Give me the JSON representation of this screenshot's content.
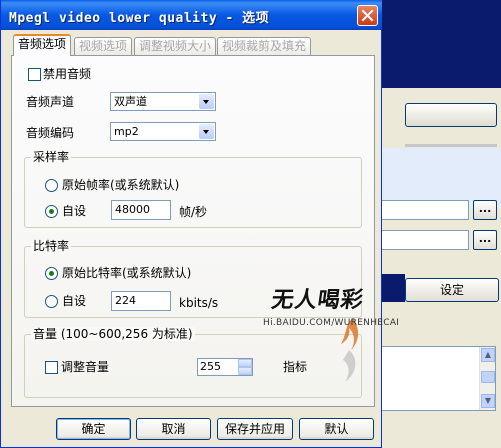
{
  "window": {
    "title": "Mpegl video lower quality - 选项"
  },
  "tabs": [
    {
      "label": "音频选项",
      "active": true
    },
    {
      "label": "视频选项",
      "active": false
    },
    {
      "label": "调整视频大小",
      "active": false
    },
    {
      "label": "视频裁剪及填充",
      "active": false
    }
  ],
  "audio": {
    "disable_label": "禁用音频",
    "disable_checked": false,
    "channel_label": "音频声道",
    "channel_value": "双声道",
    "codec_label": "音频编码",
    "codec_value": "mp2"
  },
  "sample_rate": {
    "group_title": "采样率",
    "original_label": "原始帧率(或系统默认)",
    "original_selected": false,
    "custom_label": "自设",
    "custom_selected": true,
    "custom_value": "48000",
    "unit": "帧/秒"
  },
  "bitrate": {
    "group_title": "比特率",
    "original_label": "原始比特率(或系统默认)",
    "original_selected": true,
    "custom_label": "自设",
    "custom_selected": false,
    "custom_value": "224",
    "unit": "kbits/s"
  },
  "volume": {
    "group_title": "音量 (100~600,256 为标准)",
    "adjust_label": "调整音量",
    "adjust_checked": false,
    "value": "255",
    "indicator_label": "指标"
  },
  "buttons": {
    "ok": "确定",
    "cancel": "取消",
    "save_apply": "保存并应用",
    "default": "默认"
  },
  "background_window": {
    "browse_1": "...",
    "browse_2": "...",
    "settings": "设定"
  },
  "watermark": {
    "text": "无人喝彩",
    "url": "Hi.BAIDU.COM/WURENHECAI"
  },
  "colors": {
    "titlebar": "#0758e3",
    "desktop": "#0a1b6e",
    "face": "#ece9d8",
    "tab_accent": "#e68b2c"
  }
}
